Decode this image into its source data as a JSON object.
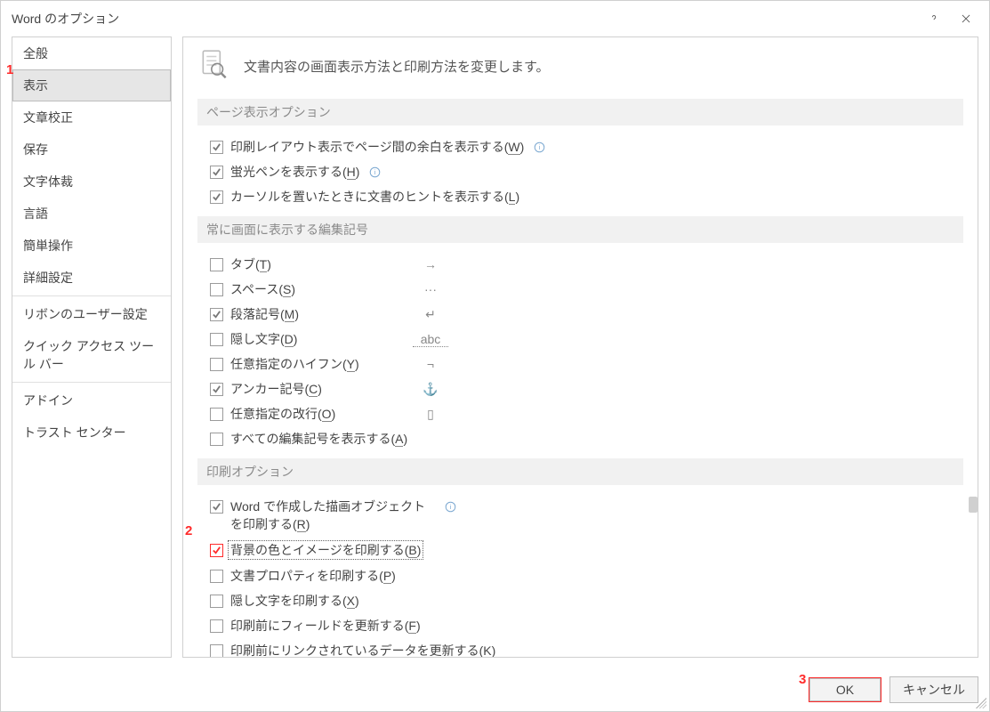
{
  "title": "Word のオプション",
  "annotations": {
    "a1": "1",
    "a2": "2",
    "a3": "3"
  },
  "sidebar": {
    "items": [
      {
        "label": "全般"
      },
      {
        "label": "表示"
      },
      {
        "label": "文章校正"
      },
      {
        "label": "保存"
      },
      {
        "label": "文字体裁"
      },
      {
        "label": "言語"
      },
      {
        "label": "簡単操作"
      },
      {
        "label": "詳細設定"
      }
    ],
    "items2": [
      {
        "label": "リボンのユーザー設定"
      },
      {
        "label": "クイック アクセス ツール バー"
      }
    ],
    "items3": [
      {
        "label": "アドイン"
      },
      {
        "label": "トラスト センター"
      }
    ]
  },
  "header": {
    "text": "文書内容の画面表示方法と印刷方法を変更します。"
  },
  "sections": {
    "s1": {
      "title": "ページ表示オプション",
      "opts": [
        {
          "pre": "印刷レイアウト表示でページ間の余白を表示する(",
          "u": "W",
          "post": ")",
          "checked": true,
          "info": true
        },
        {
          "pre": "蛍光ペンを表示する(",
          "u": "H",
          "post": ")",
          "checked": true,
          "info": true
        },
        {
          "pre": "カーソルを置いたときに文書のヒントを表示する(",
          "u": "L",
          "post": ")",
          "checked": true,
          "info": false
        }
      ]
    },
    "s2": {
      "title": "常に画面に表示する編集記号",
      "opts": [
        {
          "pre": "タブ(",
          "u": "T",
          "post": ")",
          "checked": false,
          "sym": "→"
        },
        {
          "pre": "スペース(",
          "u": "S",
          "post": ")",
          "checked": false,
          "sym": "···"
        },
        {
          "pre": "段落記号(",
          "u": "M",
          "post": ")",
          "checked": true,
          "sym": "↵"
        },
        {
          "pre": "隠し文字(",
          "u": "D",
          "post": ")",
          "checked": false,
          "sym": "abc"
        },
        {
          "pre": "任意指定のハイフン(",
          "u": "Y",
          "post": ")",
          "checked": false,
          "sym": "¬"
        },
        {
          "pre": "アンカー記号(",
          "u": "C",
          "post": ")",
          "checked": true,
          "sym": "⚓"
        },
        {
          "pre": "任意指定の改行(",
          "u": "O",
          "post": ")",
          "checked": false,
          "sym": "▯"
        },
        {
          "pre": "すべての編集記号を表示する(",
          "u": "A",
          "post": ")",
          "checked": false,
          "sym": ""
        }
      ]
    },
    "s3": {
      "title": "印刷オプション",
      "opts": [
        {
          "pre": "Word で作成した描画オブジェクトを印刷する(",
          "u": "R",
          "post": ")",
          "checked": true,
          "info": true,
          "wrap": true
        },
        {
          "pre": "背景の色とイメージを印刷する(",
          "u": "B",
          "post": ")",
          "checked": true,
          "info": false,
          "focus": true,
          "red": true
        },
        {
          "pre": "文書プロパティを印刷する(",
          "u": "P",
          "post": ")",
          "checked": false,
          "info": false
        },
        {
          "pre": "隠し文字を印刷する(",
          "u": "X",
          "post": ")",
          "checked": false,
          "info": false
        },
        {
          "pre": "印刷前にフィールドを更新する(",
          "u": "F",
          "post": ")",
          "checked": false,
          "info": false
        },
        {
          "pre": "印刷前にリンクされているデータを更新する(",
          "u": "K",
          "post": ")",
          "checked": false,
          "info": false
        }
      ]
    }
  },
  "footer": {
    "ok": "OK",
    "cancel": "キャンセル"
  }
}
